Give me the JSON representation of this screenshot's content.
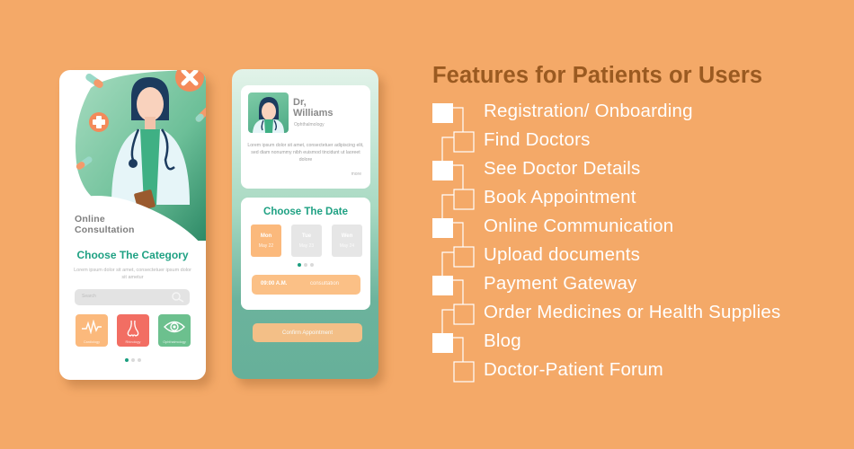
{
  "colors": {
    "background": "#f4a968",
    "accent_green": "#1fa183",
    "title_brown": "#9a5a21",
    "orange_tile": "#fbb97c",
    "red_tile": "#f26e63",
    "green_tile": "#6cc08e",
    "inactive_gray": "#e6e6e6"
  },
  "phone1": {
    "hero_title": "Online Consultation",
    "category_title": "Choose The Category",
    "category_description": "Lorem ipsum dolor sit amet, consectetuer ipsum dolor sit ametur",
    "search": {
      "placeholder": "Search",
      "icon": "search-icon"
    },
    "categories": [
      {
        "label": "Cardiology",
        "icon": "heartbeat-icon",
        "color": "#fbb97c"
      },
      {
        "label": "Rhinology",
        "icon": "nose-icon",
        "color": "#f26e63"
      },
      {
        "label": "Ophthalmology",
        "icon": "eye-icon",
        "color": "#6cc08e"
      }
    ],
    "pager": {
      "count": 3,
      "active": 0
    }
  },
  "phone2": {
    "doctor": {
      "name_line1": "Dr,",
      "name_line2": "Williams",
      "specialty": "Ophthalmology",
      "description": "Lorem ipsum dolor sit amet, consectetuer adipiscing elit, sed diam nonummy nibh euismod tincidunt ut laoreet dolore",
      "more_link": "more"
    },
    "date_picker": {
      "title": "Choose The Date",
      "dates": [
        {
          "day": "Mon",
          "date": "May 22",
          "selected": true
        },
        {
          "day": "Tue",
          "date": "May 23",
          "selected": false
        },
        {
          "day": "Wen",
          "date": "May 24",
          "selected": false
        }
      ],
      "pager": {
        "count": 3,
        "active": 0
      },
      "slot": {
        "time": "09:00 A.M.",
        "type": "consultation"
      }
    },
    "confirm_button": "Confirm Appointment"
  },
  "features": {
    "title": "Features for Patients or Users",
    "items": [
      {
        "label": "Registration/ Onboarding",
        "marker": "filled"
      },
      {
        "label": "Find Doctors",
        "marker": "outline"
      },
      {
        "label": "See Doctor Details",
        "marker": "filled"
      },
      {
        "label": "Book Appointment",
        "marker": "outline"
      },
      {
        "label": "Online Communication",
        "marker": "filled"
      },
      {
        "label": "Upload documents",
        "marker": "outline"
      },
      {
        "label": "Payment Gateway",
        "marker": "filled"
      },
      {
        "label": "Order Medicines or Health Supplies",
        "marker": "outline"
      },
      {
        "label": "Blog",
        "marker": "filled"
      },
      {
        "label": "Doctor-Patient Forum",
        "marker": "outline"
      }
    ]
  }
}
